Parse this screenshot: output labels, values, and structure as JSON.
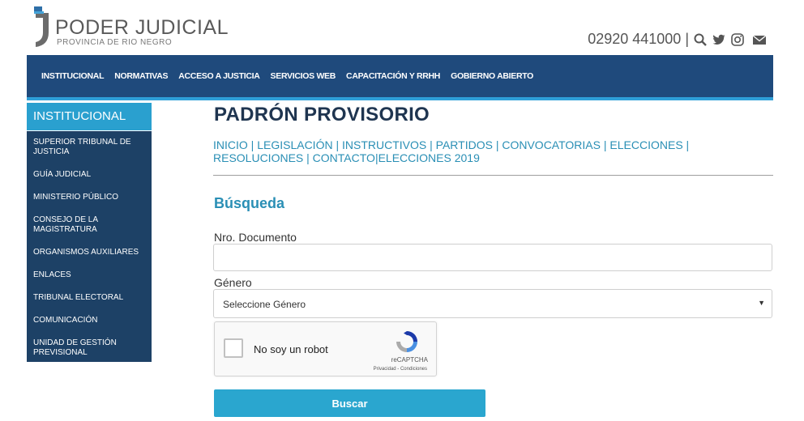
{
  "header": {
    "logo_title": "PODER JUDICIAL",
    "logo_subtitle": "PROVINCIA DE RIO NEGRO",
    "phone": "02920 441000",
    "separator": "|",
    "icons": [
      "search-icon",
      "twitter-icon",
      "instagram-icon",
      "mail-icon"
    ]
  },
  "topnav": {
    "items": [
      "INSTITUCIONAL",
      "NORMATIVAS",
      "ACCESO A JUSTICIA",
      "SERVICIOS WEB",
      "CAPACITACIÓN Y RRHH",
      "GOBIERNO ABIERTO"
    ]
  },
  "sidebar": {
    "heading": "INSTITUCIONAL",
    "items": [
      {
        "label": "SUPERIOR TRIBUNAL DE JUSTICIA"
      },
      {
        "label": "GUÍA JUDICIAL"
      },
      {
        "label": "MINISTERIO PÚBLICO"
      },
      {
        "label": "CONSEJO DE LA MAGISTRATURA"
      },
      {
        "label": "ORGANISMOS AUXILIARES"
      },
      {
        "label": "ENLACES"
      },
      {
        "label": "TRIBUNAL ELECTORAL"
      },
      {
        "label": "COMUNICACIÓN"
      },
      {
        "label": "UNIDAD DE GESTIÓN PREVISIONAL"
      }
    ]
  },
  "main": {
    "title": "PADRÓN PROVISORIO",
    "breadcrumb": [
      "INICIO",
      "LEGISLACIÓN",
      "INSTRUCTIVOS",
      "PARTIDOS",
      "CONVOCATORIAS",
      "ELECCIONES",
      "RESOLUCIONES",
      "CONTACTO",
      "ELECCIONES 2019"
    ],
    "breadcrumb_separator": "|",
    "section_title": "Búsqueda",
    "doc_label": "Nro. Documento",
    "doc_value": "",
    "doc_placeholder": "",
    "gender_label": "Género",
    "gender_selected": "Seleccione Género",
    "submit_label": "Buscar"
  },
  "recaptcha": {
    "checkbox_label": "No soy un robot",
    "brand": "reCAPTCHA",
    "links": "Privacidad - Condiciones"
  },
  "colors": {
    "nav_bg": "#1f4a7c",
    "accent": "#2aa0cf",
    "sidebar_bg": "#1d4166",
    "title": "#1f3550",
    "link": "#2a8fb5"
  }
}
